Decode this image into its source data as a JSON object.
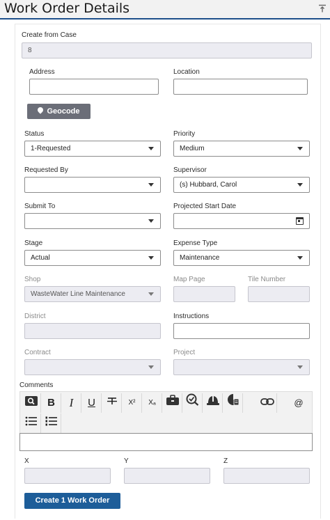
{
  "header": {
    "title": "Work Order Details",
    "pin_icon": "pin-to-top-icon"
  },
  "form": {
    "create_from_case": {
      "label": "Create from Case",
      "value": "8"
    },
    "address": {
      "label": "Address",
      "value": ""
    },
    "location": {
      "label": "Location",
      "value": ""
    },
    "geocode_button": "Geocode",
    "status": {
      "label": "Status",
      "value": "1-Requested"
    },
    "priority": {
      "label": "Priority",
      "value": "Medium"
    },
    "requested_by": {
      "label": "Requested By",
      "value": ""
    },
    "supervisor": {
      "label": "Supervisor",
      "value": "(s) Hubbard, Carol"
    },
    "submit_to": {
      "label": "Submit To",
      "value": ""
    },
    "projected_start_date": {
      "label": "Projected Start Date",
      "value": ""
    },
    "stage": {
      "label": "Stage",
      "value": "Actual"
    },
    "expense_type": {
      "label": "Expense Type",
      "value": "Maintenance"
    },
    "shop": {
      "label": "Shop",
      "value": "WasteWater Line Maintenance"
    },
    "map_page": {
      "label": "Map Page",
      "value": ""
    },
    "tile_number": {
      "label": "Tile Number",
      "value": ""
    },
    "district": {
      "label": "District",
      "value": ""
    },
    "instructions": {
      "label": "Instructions",
      "value": ""
    },
    "contract": {
      "label": "Contract",
      "value": ""
    },
    "project": {
      "label": "Project",
      "value": ""
    },
    "comments": {
      "label": "Comments",
      "value": ""
    },
    "x": {
      "label": "X",
      "value": ""
    },
    "y": {
      "label": "Y",
      "value": ""
    },
    "z": {
      "label": "Z",
      "value": ""
    }
  },
  "toolbar": {
    "find": "🔍",
    "bold": "B",
    "italic": "I",
    "underline": "U",
    "strike": "S",
    "superscript": "X²",
    "subscript": "Xₐ",
    "at": "@"
  },
  "create_button": "Create 1 Work Order",
  "colors": {
    "header_border": "#1d4f8b",
    "primary_button": "#1d5d99",
    "geocode_button": "#6b6e78",
    "disabled_field": "#ececf2"
  }
}
